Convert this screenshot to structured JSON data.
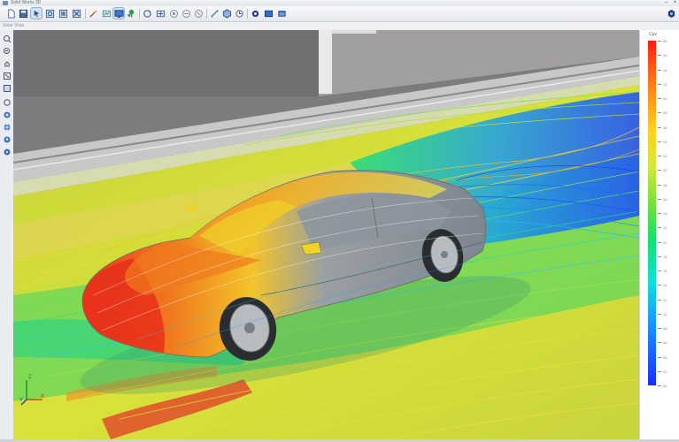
{
  "window": {
    "title": "Solid Works  3D",
    "minimize": "–",
    "close": "×"
  },
  "subbar": {
    "text": "Solar Vista"
  },
  "legend": {
    "title": "Cpv",
    "ticks": [
      "48",
      "46",
      "44",
      "42",
      "40",
      "38",
      "36",
      "34",
      "32",
      "30",
      "28",
      "26",
      "24",
      "22",
      "20",
      "18",
      "16",
      "14",
      "12",
      "10",
      "08",
      "06",
      "04",
      "02",
      "00"
    ]
  },
  "axes": {
    "x": "X",
    "y": "Y",
    "z": "Z"
  },
  "colors": {
    "accent": "#cfe0f4",
    "road": "#d9e23a",
    "wall": "#7e7f80",
    "car_front": "#e83a1a",
    "stream_cold": "#1a4cff"
  },
  "icons": {
    "toolbar": [
      "new-document-icon",
      "save-icon",
      "select-icon",
      "zoom-window-icon",
      "zoom-all-icon",
      "zoom-fit-icon",
      "magic-wand-icon",
      "view-icon",
      "display-icon",
      "tree-icon",
      "rotate-icon",
      "pan-icon",
      "orbit-a-icon",
      "orbit-b-icon",
      "orbit-c-icon",
      "measure-icon",
      "section-icon",
      "dimension-icon",
      "record-icon",
      "screen-icon",
      "window-icon",
      "camera-icon"
    ],
    "side": [
      "zoom-in-icon",
      "zoom-out-icon",
      "pan-icon",
      "fit-icon",
      "frame-icon",
      "rotate-icon",
      "light-icon",
      "grid-icon",
      "navigate-icon",
      "axis-icon"
    ]
  }
}
